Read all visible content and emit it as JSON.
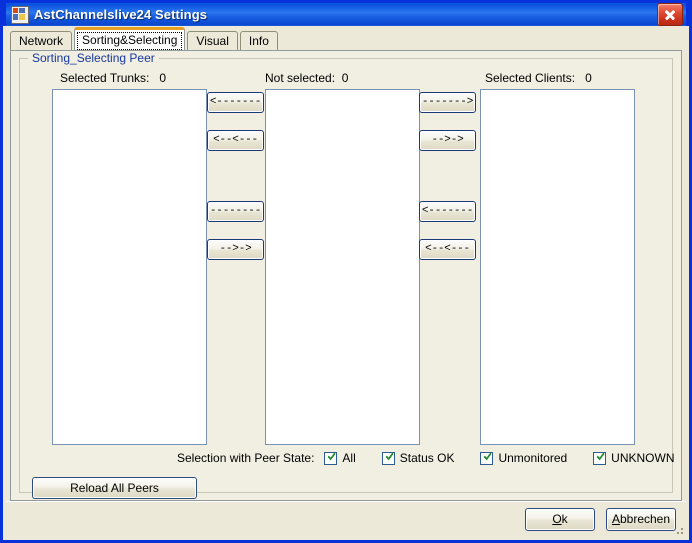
{
  "window": {
    "title": "AstChannelslive24 Settings",
    "icon": "app-icon",
    "close_icon": "close-icon",
    "titlebar_color": "#0A52E0",
    "face_color": "#ECE9D8"
  },
  "tabs": [
    {
      "label": "Network",
      "active": false
    },
    {
      "label": "Sorting&Selecting",
      "active": true
    },
    {
      "label": "Visual",
      "active": false
    },
    {
      "label": "Info",
      "active": false
    }
  ],
  "group": {
    "legend": "Sorting_Selecting Peer",
    "legend_color": "#18379E"
  },
  "columns": {
    "trunks": {
      "label": "Selected Trunks:",
      "count": "0",
      "items": []
    },
    "not_selected": {
      "label": "Not selected:",
      "count": "0",
      "items": []
    },
    "clients": {
      "label": "Selected Clients:",
      "count": "0",
      "items": []
    }
  },
  "left_buttons": [
    {
      "label": "<--------",
      "name": "move-all-to-trunks-button"
    },
    {
      "label": "<--<---",
      "name": "move-selected-to-trunks-button"
    },
    {
      "label": "-------->",
      "name": "move-all-trunks-back-button"
    },
    {
      "label": "-->->",
      "name": "move-selected-trunks-back-button"
    }
  ],
  "right_buttons": [
    {
      "label": "------->",
      "name": "move-all-to-clients-button"
    },
    {
      "label": "-->->",
      "name": "move-selected-to-clients-button"
    },
    {
      "label": "<-------",
      "name": "move-all-clients-back-button"
    },
    {
      "label": "<--<---",
      "name": "move-selected-clients-back-button"
    }
  ],
  "peer_state": {
    "label": "Selection with Peer State:",
    "options": [
      {
        "label": "All",
        "checked": true
      },
      {
        "label": "Status OK",
        "checked": true
      },
      {
        "label": "Unmonitored",
        "checked": true
      },
      {
        "label": "UNKNOWN",
        "checked": true
      }
    ],
    "check_color": "#1E8B28"
  },
  "actions": {
    "reload": "Reload All Peers"
  },
  "dialog_buttons": {
    "ok": {
      "prefix": "O",
      "rest": "k"
    },
    "cancel": {
      "prefix": "A",
      "rest": "bbrechen"
    }
  }
}
